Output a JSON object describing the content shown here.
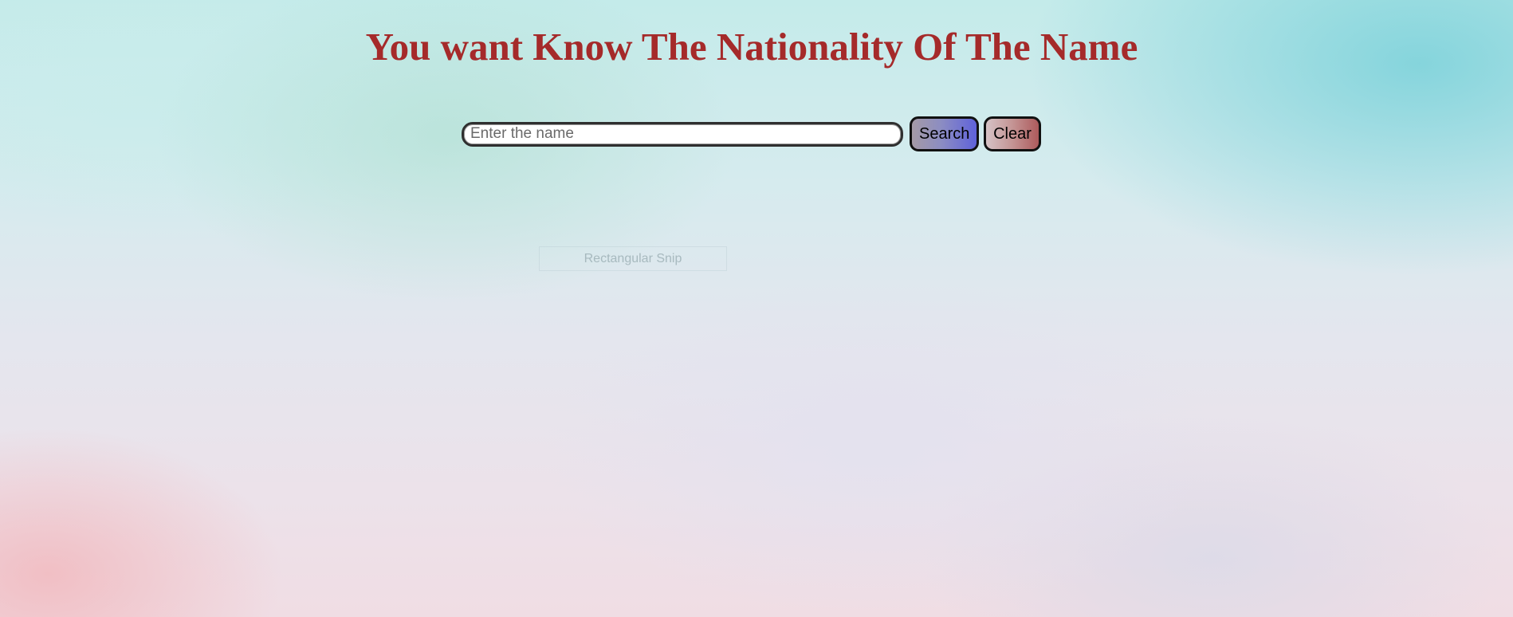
{
  "page": {
    "title": "You want Know The Nationality Of The Name",
    "title_color": "#a52a2a"
  },
  "search": {
    "placeholder": "Enter the name",
    "value": "",
    "search_label": "Search",
    "clear_label": "Clear"
  },
  "overlay": {
    "label": "Rectangular Snip"
  }
}
